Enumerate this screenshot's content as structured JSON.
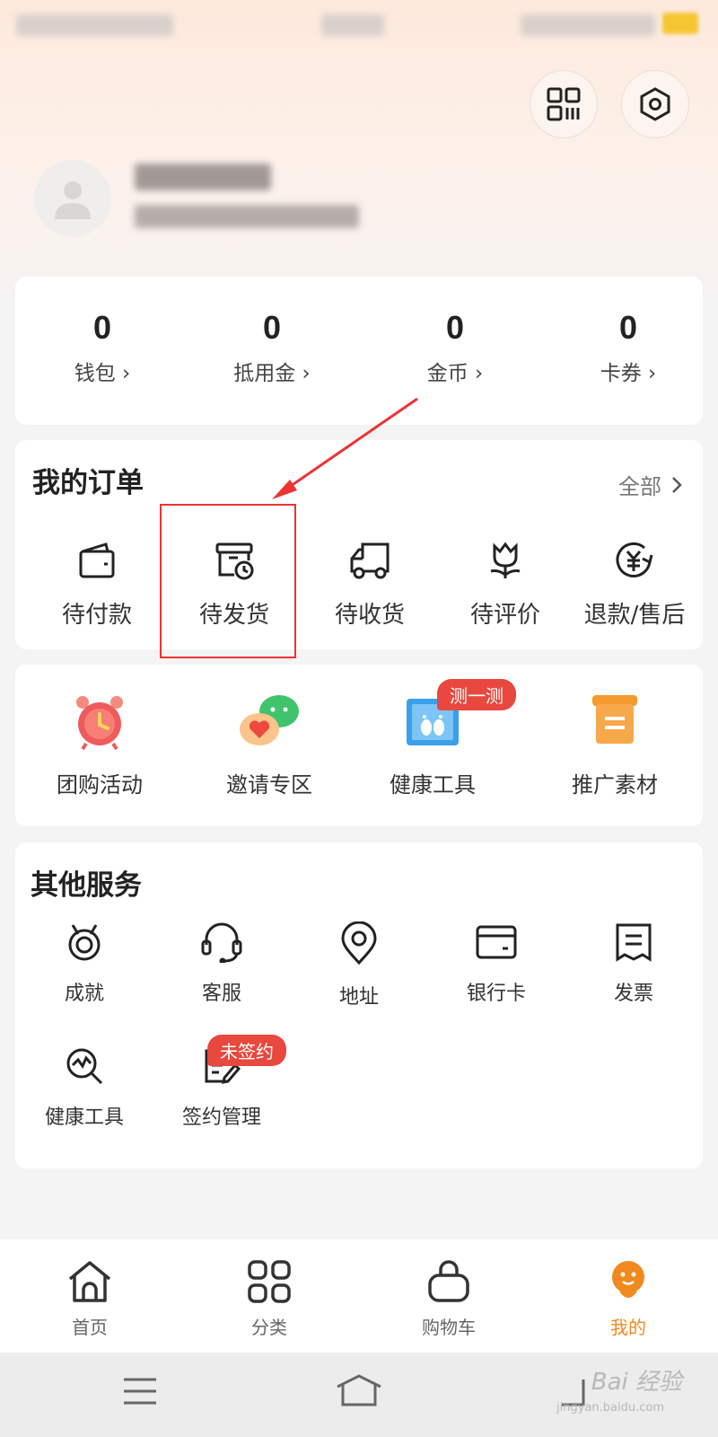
{
  "assets": [
    {
      "value": "0",
      "label": "钱包 ›"
    },
    {
      "value": "0",
      "label": "抵用金 ›"
    },
    {
      "value": "0",
      "label": "金币 ›"
    },
    {
      "value": "0",
      "label": "卡券 ›"
    }
  ],
  "orders": {
    "title": "我的订单",
    "see_all": "全部",
    "items": [
      {
        "label": "待付款",
        "icon": "wallet-icon"
      },
      {
        "label": "待发货",
        "icon": "package-clock-icon"
      },
      {
        "label": "待收货",
        "icon": "truck-icon"
      },
      {
        "label": "待评价",
        "icon": "tulip-icon"
      },
      {
        "label": "退款/售后",
        "icon": "yuan-refund-icon"
      }
    ]
  },
  "promos": [
    {
      "label": "团购活动",
      "icon": "alarm-clock-icon"
    },
    {
      "label": "邀请专区",
      "icon": "chat-heart-icon"
    },
    {
      "label": "健康工具",
      "icon": "baby-footprint-icon",
      "badge": "测一测"
    },
    {
      "label": "推广素材",
      "icon": "scroll-icon"
    }
  ],
  "services": {
    "title": "其他服务",
    "items": [
      {
        "label": "成就",
        "icon": "medal-icon"
      },
      {
        "label": "客服",
        "icon": "headset-icon"
      },
      {
        "label": "地址",
        "icon": "location-pin-icon"
      },
      {
        "label": "银行卡",
        "icon": "bank-card-icon"
      },
      {
        "label": "发票",
        "icon": "invoice-icon"
      },
      {
        "label": "健康工具",
        "icon": "health-search-icon"
      },
      {
        "label": "签约管理",
        "icon": "contract-sign-icon",
        "badge": "未签约"
      }
    ]
  },
  "tabbar": [
    {
      "label": "首页",
      "icon": "home-icon",
      "active": false
    },
    {
      "label": "分类",
      "icon": "grid-icon",
      "active": false
    },
    {
      "label": "购物车",
      "icon": "shopping-bag-icon",
      "active": false
    },
    {
      "label": "我的",
      "icon": "mascot-icon",
      "active": true
    }
  ],
  "watermark": {
    "main": "Bai 经验",
    "sub": "jingyan.baidu.com"
  },
  "colors": {
    "accent": "#f08a1f",
    "badge": "#e8483e",
    "annotation": "#ee3333"
  }
}
